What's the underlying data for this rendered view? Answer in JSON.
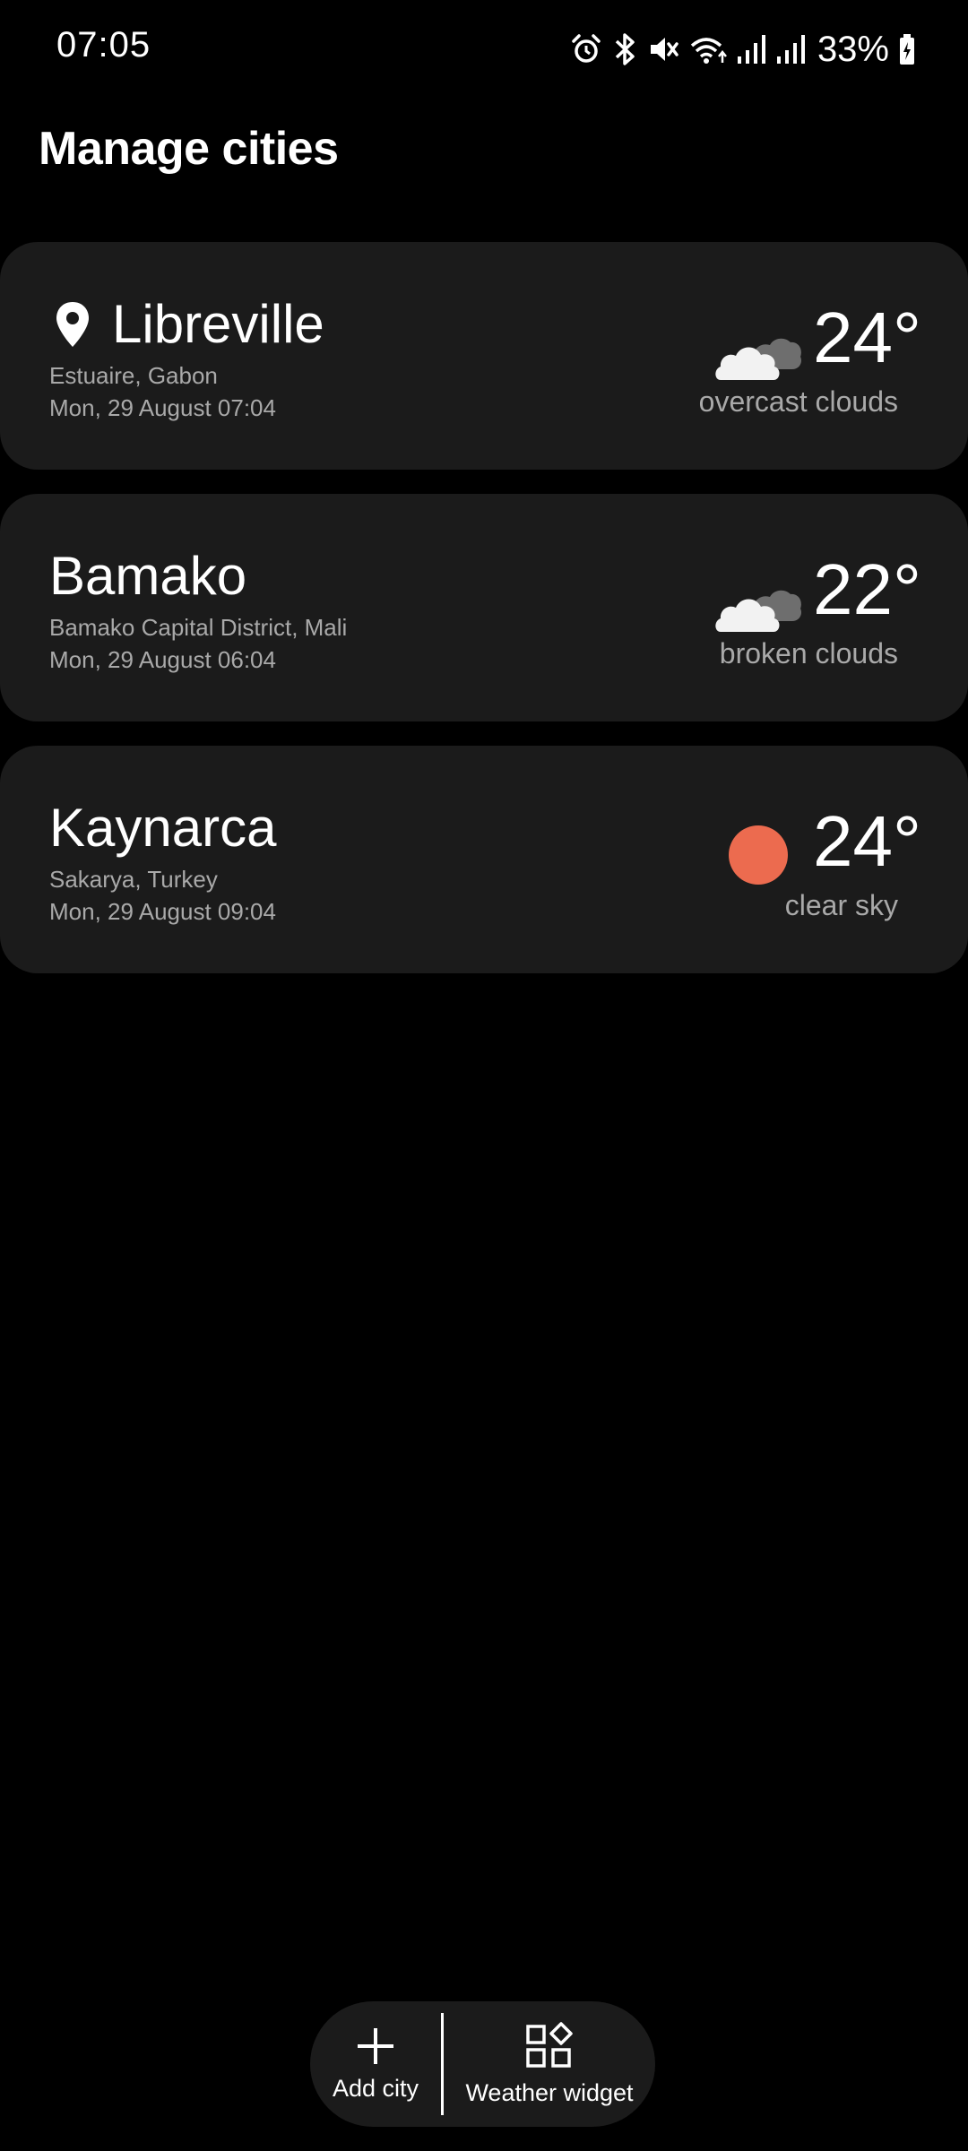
{
  "status_bar": {
    "time": "07:05",
    "icons": [
      "alarm-icon",
      "bluetooth-icon",
      "mute-icon",
      "wifi-icon",
      "signal-icon",
      "signal-icon"
    ],
    "battery": "33%"
  },
  "page": {
    "title": "Manage cities"
  },
  "cities": [
    {
      "name": "Libreville",
      "current_location": true,
      "region": "Estuaire, Gabon",
      "datetime": "Mon, 29 August 07:04",
      "temperature": "24°",
      "condition": "overcast clouds",
      "icon": "cloud-icon"
    },
    {
      "name": "Bamako",
      "current_location": false,
      "region": "Bamako Capital District, Mali",
      "datetime": "Mon, 29 August 06:04",
      "temperature": "22°",
      "condition": "broken clouds",
      "icon": "cloud-icon"
    },
    {
      "name": "Kaynarca",
      "current_location": false,
      "region": "Sakarya, Turkey",
      "datetime": "Mon, 29 August 09:04",
      "temperature": "24°",
      "condition": "clear sky",
      "icon": "sun-icon"
    }
  ],
  "actions": {
    "add_city_label": "Add city",
    "weather_widget_label": "Weather widget"
  },
  "colors": {
    "background": "#000000",
    "card": "#1b1b1b",
    "secondary_text": "#a9a9a9",
    "sun": "#ec6b4f",
    "cloud_front": "#f2f2f2",
    "cloud_back": "#6e6e6e"
  }
}
